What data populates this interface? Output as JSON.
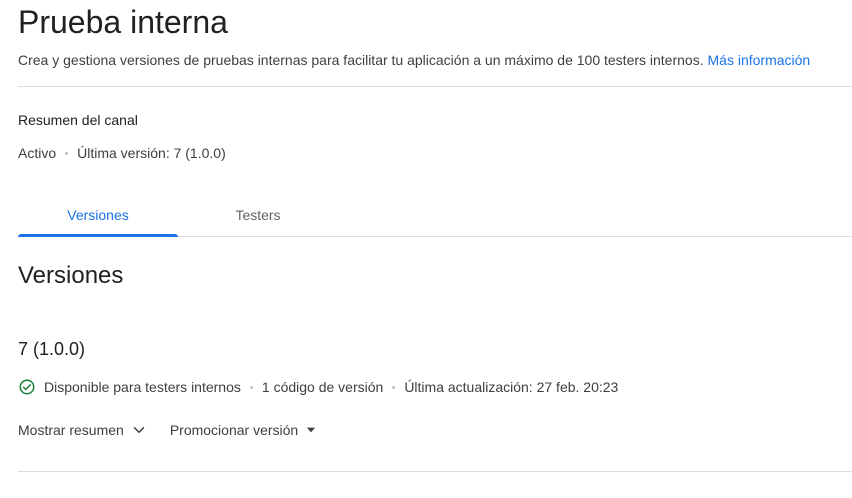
{
  "header": {
    "title": "Prueba interna",
    "description": "Crea y gestiona versiones de pruebas internas para facilitar tu aplicación a un máximo de 100 testers internos.",
    "learn_more": "Más información"
  },
  "channel_summary": {
    "label": "Resumen del canal",
    "status": "Activo",
    "latest_version": "Última versión: 7 (1.0.0)"
  },
  "tabs": [
    {
      "label": "Versiones",
      "active": true
    },
    {
      "label": "Testers",
      "active": false
    }
  ],
  "releases_section": {
    "heading": "Versiones"
  },
  "release": {
    "name": "7 (1.0.0)",
    "availability": "Disponible para testers internos",
    "version_codes": "1 código de versión",
    "last_updated": "Última actualización: 27 feb. 20:23",
    "status_icon": "check-circle-icon",
    "status_color": "#188038"
  },
  "actions": {
    "show_summary": "Mostrar resumen",
    "promote_release": "Promocionar versión"
  },
  "colors": {
    "accent": "#1a73e8",
    "text": "#202124",
    "secondary_text": "#3c4043",
    "divider": "#dadce0"
  }
}
